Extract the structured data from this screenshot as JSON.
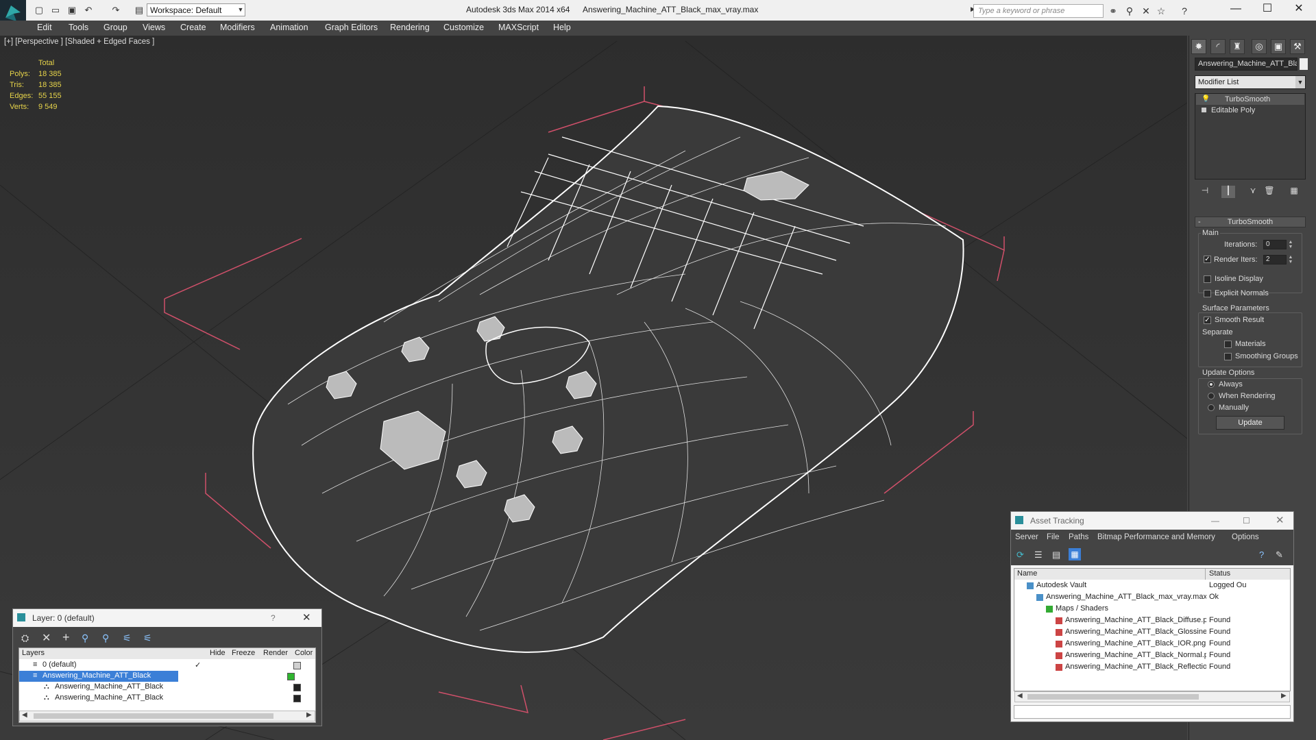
{
  "titlebar": {
    "workspace": "Workspace: Default",
    "app_title": "Autodesk 3ds Max  2014 x64",
    "doc_title": "Answering_Machine_ATT_Black_max_vray.max",
    "search_placeholder": "Type a keyword or phrase",
    "icons": [
      "new-icon",
      "open-icon",
      "save-icon",
      "undo-icon",
      "redo-icon",
      "project-folder-icon"
    ],
    "window_controls": [
      "minimize",
      "maximize",
      "close"
    ]
  },
  "menu": [
    "Edit",
    "Tools",
    "Group",
    "Views",
    "Create",
    "Modifiers",
    "Animation",
    "Graph Editors",
    "Rendering",
    "Customize",
    "MAXScript",
    "Help"
  ],
  "viewport": {
    "label": "[+] [Perspective ] [Shaded + Edged Faces ]",
    "stats": {
      "header": "Total",
      "rows": [
        {
          "label": "Polys:",
          "value": "18 385"
        },
        {
          "label": "Tris:",
          "value": "18 385"
        },
        {
          "label": "Edges:",
          "value": "55 155"
        },
        {
          "label": "Verts:",
          "value": "9 549"
        }
      ]
    }
  },
  "command_panel": {
    "object_name": "Answering_Machine_ATT_Bla",
    "modifier_list": "Modifier List",
    "stack": [
      "TurboSmooth",
      "Editable Poly"
    ],
    "turbosmooth": {
      "title": "TurboSmooth",
      "main_label": "Main",
      "iterations_label": "Iterations:",
      "iterations_value": "0",
      "render_iters_label": "Render Iters:",
      "render_iters_value": "2",
      "render_iters_checked": true,
      "isoline_display": "Isoline Display",
      "explicit_normals": "Explicit Normals",
      "surface_params": "Surface Parameters",
      "smooth_result": "Smooth Result",
      "separate": "Separate",
      "materials": "Materials",
      "smoothing_groups": "Smoothing Groups",
      "update_options": "Update Options",
      "always": "Always",
      "when_rendering": "When Rendering",
      "manually": "Manually",
      "update_button": "Update"
    }
  },
  "layer_window": {
    "title": "Layer: 0 (default)",
    "help": "?",
    "columns": [
      "Layers",
      "Hide",
      "Freeze",
      "Render",
      "Color"
    ],
    "rows": [
      {
        "name": "0 (default)",
        "color": "#d0d0d0",
        "selected": false,
        "indent": 1
      },
      {
        "name": "Answering_Machine_ATT_Black",
        "color": "#2fb52f",
        "selected": true,
        "indent": 1
      },
      {
        "name": "Answering_Machine_ATT_Black",
        "color": "#222222",
        "selected": false,
        "indent": 2
      },
      {
        "name": "Answering_Machine_ATT_Black",
        "color": "#222222",
        "selected": false,
        "indent": 2
      }
    ]
  },
  "asset_window": {
    "title": "Asset Tracking",
    "menu": [
      "Server",
      "File",
      "Paths",
      "Bitmap Performance and Memory",
      "Options"
    ],
    "columns": [
      "Name",
      "Status"
    ],
    "rows": [
      {
        "name": "Autodesk Vault",
        "status": "Logged Ou",
        "indent": 1
      },
      {
        "name": "Answering_Machine_ATT_Black_max_vray.max",
        "status": "Ok",
        "indent": 2
      },
      {
        "name": "Maps / Shaders",
        "status": "",
        "indent": 3
      },
      {
        "name": "Answering_Machine_ATT_Black_Diffuse.png",
        "status": "Found",
        "indent": 4
      },
      {
        "name": "Answering_Machine_ATT_Black_Glossiness.png",
        "status": "Found",
        "indent": 4
      },
      {
        "name": "Answering_Machine_ATT_Black_IOR.png",
        "status": "Found",
        "indent": 4
      },
      {
        "name": "Answering_Machine_ATT_Black_Normal.png",
        "status": "Found",
        "indent": 4
      },
      {
        "name": "Answering_Machine_ATT_Black_Reflection.png",
        "status": "Found",
        "indent": 4
      }
    ]
  }
}
